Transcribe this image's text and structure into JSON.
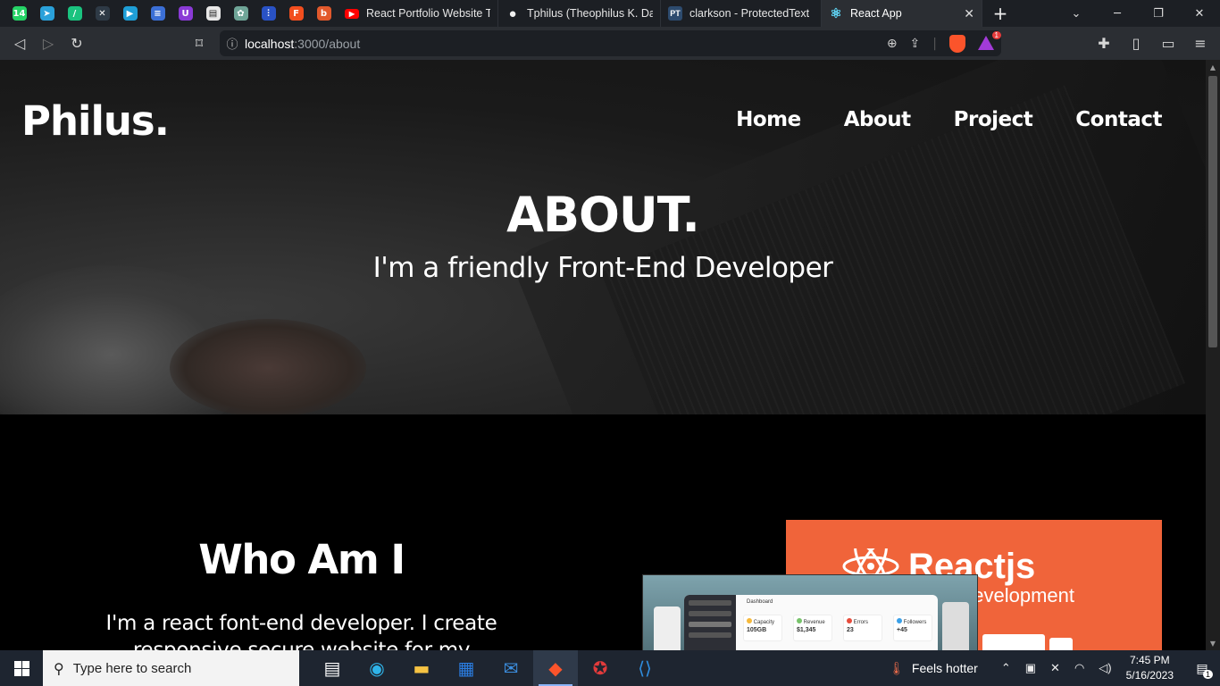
{
  "browser": {
    "pinned_tabs": [
      {
        "icon": "whatsapp-icon",
        "glyph": "14",
        "color": "#25d366"
      },
      {
        "icon": "telegram-icon",
        "glyph": "➤",
        "color": "#2aa1da"
      },
      {
        "icon": "slack-like-icon",
        "glyph": "/",
        "color": "#1ac37f"
      },
      {
        "icon": "x-tool-icon",
        "glyph": "✕",
        "color": "#2e3a46"
      },
      {
        "icon": "play-icon",
        "glyph": "▶",
        "color": "#1e9ed6"
      },
      {
        "icon": "docs-icon",
        "glyph": "≡",
        "color": "#3b6fd6"
      },
      {
        "icon": "u-app-icon",
        "glyph": "U",
        "color": "#8a3ad6"
      },
      {
        "icon": "news-icon",
        "glyph": "▤",
        "color": "#e8e8e8"
      },
      {
        "icon": "chatgpt-icon",
        "glyph": "✿",
        "color": "#6fa598"
      },
      {
        "icon": "bars-icon",
        "glyph": "⫶",
        "color": "#2952c5"
      },
      {
        "icon": "figma-icon",
        "glyph": "F",
        "color": "#f24e1e"
      },
      {
        "icon": "b-app-icon",
        "glyph": "b",
        "color": "#e2592c"
      }
    ],
    "tabs": [
      {
        "label": "React Portfolio Website Tut",
        "icon": "youtube-icon",
        "glyph": "▶",
        "color": "#ff0000",
        "width": 180
      },
      {
        "label": "Tphilus (Theophilus K. Dadz",
        "icon": "github-icon",
        "glyph": "●",
        "color": "#f0f0f0",
        "width": 182
      },
      {
        "label": "clarkson - ProtectedText",
        "icon": "protectedtext-icon",
        "glyph": "PT",
        "color": "#2d4b6e",
        "width": 180
      }
    ],
    "active_tab": {
      "label": "React App",
      "icon": "react-icon",
      "glyph": "⚛",
      "color": "#61dafb"
    },
    "url_host": "localhost",
    "url_rest": ":3000/about",
    "reward_badge": "1"
  },
  "site": {
    "logo": "Philus.",
    "nav": [
      "Home",
      "About",
      "Project",
      "Contact"
    ],
    "hero_title": "ABOUT.",
    "hero_subtitle": "I'm a friendly Front-End Developer",
    "who_title": "Who Am I",
    "who_text": "I'm a react font-end developer. I create responsive secure website for my clients."
  },
  "project_image": {
    "title": "Reactjs",
    "subtitle": "e Development",
    "bg": "#f0643a",
    "dashboard": {
      "heading": "Dashboard",
      "stats": [
        {
          "label": "Capacity",
          "value": "105GB"
        },
        {
          "label": "Revenue",
          "value": "$1,345"
        },
        {
          "label": "Errors",
          "value": "23"
        },
        {
          "label": "Followers",
          "value": "+45"
        }
      ]
    }
  },
  "taskbar": {
    "search_placeholder": "Type here to search",
    "apps": [
      "task-view-icon",
      "edge-icon",
      "file-explorer-icon",
      "ms-store-icon",
      "mail-icon",
      "brave-icon",
      "game-icon",
      "vscode-icon"
    ],
    "weather": "Feels hotter",
    "time": "7:45 PM",
    "date": "5/16/2023",
    "notification_count": "1"
  }
}
